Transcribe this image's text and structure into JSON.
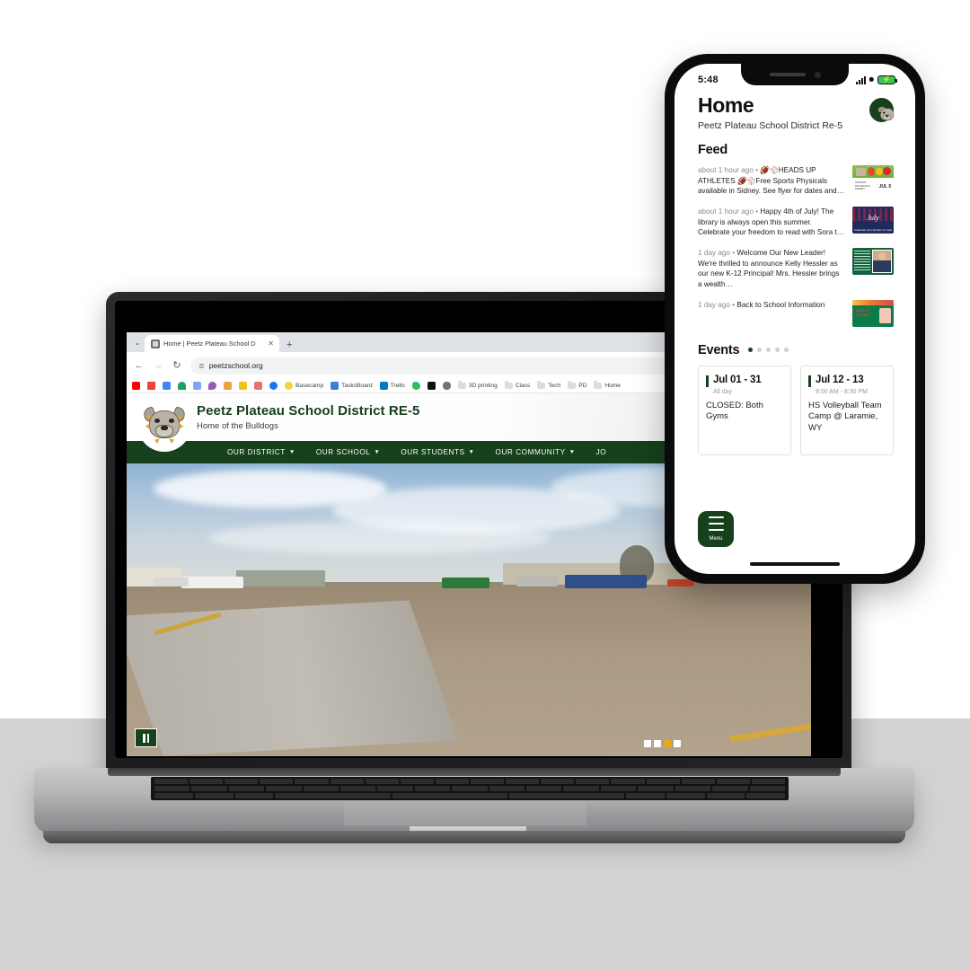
{
  "scene": {
    "background_top": "#ffffff",
    "background_bottom": "#d2d2d2"
  },
  "laptop": {
    "browser": {
      "tab": {
        "title": "Home | Peetz Plateau School D",
        "close_label": "✕",
        "new_tab_label": "+",
        "tab_list_chevron": "⌄"
      },
      "toolbar": {
        "back": "←",
        "forward": "→",
        "reload": "↻",
        "site_settings_icon": "site-settings-icon",
        "url": "peetzschool.org",
        "bookmark_star": "★"
      },
      "extensions": [
        {
          "name": "adblock-extension-icon",
          "color": "#e04a3f"
        },
        {
          "name": "analytics-extension-icon",
          "color": "#1f7a4d"
        },
        {
          "name": "grammar-extension-icon",
          "color": "#3ba55d"
        },
        {
          "name": "privacy-extension-icon",
          "color": "#34c08a"
        },
        {
          "name": "notes-extension-icon",
          "color": "#d8a43a"
        }
      ],
      "bookmarks": [
        {
          "label": "",
          "name": "bookmark-youtube",
          "color": "#ff0000"
        },
        {
          "label": "",
          "name": "bookmark-gmail",
          "color": "#ea4335"
        },
        {
          "label": "",
          "name": "bookmark-calendar",
          "color": "#4285f4"
        },
        {
          "label": "",
          "name": "bookmark-google-drive",
          "color": "#1aa260"
        },
        {
          "label": "",
          "name": "bookmark-photos",
          "color": "#4285f4"
        },
        {
          "label": "",
          "name": "bookmark-brave",
          "color": "#9b59b6"
        },
        {
          "label": "",
          "name": "bookmark-slack",
          "color": "#e8a33d"
        },
        {
          "label": "",
          "name": "bookmark-mailchimp",
          "color": "#ffe01b"
        },
        {
          "label": "",
          "name": "bookmark-dropbox",
          "color": "#e8554e"
        },
        {
          "label": "",
          "name": "bookmark-facebook",
          "color": "#1877f2"
        },
        {
          "label": "Basecamp",
          "name": "bookmark-basecamp",
          "color": "#f5d33f"
        },
        {
          "label": "TasksBoard",
          "name": "bookmark-tasksboard",
          "color": "#3b7ddd"
        },
        {
          "label": "Trello",
          "name": "bookmark-trello",
          "color": "#0079bf"
        },
        {
          "label": "",
          "name": "bookmark-evernote",
          "color": "#2dbe60"
        },
        {
          "label": "",
          "name": "bookmark-x",
          "color": "#111111"
        },
        {
          "label": "",
          "name": "bookmark-bulldog",
          "color": "#7a7468"
        },
        {
          "label": "3D printing",
          "name": "bookmark-folder-3d-printing",
          "color": "#dadce0"
        },
        {
          "label": "Class",
          "name": "bookmark-folder-class",
          "color": "#dadce0"
        },
        {
          "label": "Tech",
          "name": "bookmark-folder-tech",
          "color": "#dadce0"
        },
        {
          "label": "PD",
          "name": "bookmark-folder-pd",
          "color": "#dadce0"
        },
        {
          "label": "Home",
          "name": "bookmark-folder-home",
          "color": "#dadce0"
        }
      ]
    },
    "site": {
      "title": "Peetz Plateau School District RE-5",
      "tagline": "Home of the Bulldogs",
      "brand_color": "#17401c",
      "nav": [
        {
          "label": "OUR DISTRICT",
          "has_dropdown": true
        },
        {
          "label": "OUR SCHOOL",
          "has_dropdown": true
        },
        {
          "label": "OUR STUDENTS",
          "has_dropdown": true
        },
        {
          "label": "OUR COMMUNITY",
          "has_dropdown": true
        },
        {
          "label": "JO",
          "has_dropdown": false
        }
      ],
      "carousel": {
        "pause_label": "‖",
        "slide_count": 4,
        "active_slide": 3,
        "active_color": "#e8a820"
      }
    }
  },
  "phone": {
    "status_bar": {
      "time": "5:48",
      "cellular_icon": "cellular-signal-icon",
      "wifi_icon": "wifi-icon",
      "battery_icon": "battery-charging-icon",
      "battery_charging_glyph": "⚡"
    },
    "header": {
      "title": "Home",
      "subtitle": "Peetz Plateau School District Re-5",
      "avatar_name": "school-logo-avatar"
    },
    "feed": {
      "section_title": "Feed",
      "items": [
        {
          "ago": "about 1 hour ago",
          "separator": "•",
          "text": "🏈⚾HEADS UP ATHLETES 🏈⚾Free Sports Physicals available in Sidney. See flyer for dates and…",
          "thumb": "sports-physicals-flyer"
        },
        {
          "ago": "about 1 hour ago",
          "separator": "•",
          "text": "Happy 4th of July! The library is always open this summer. Celebrate your freedom to read with Sora t…",
          "thumb": "july-fourth-flyer"
        },
        {
          "ago": "1 day ago",
          "separator": "•",
          "text": "Welcome Our New Leader! We're thrilled to announce Kelly Hessler as our new K-12 Principal! Mrs. Hessler brings a wealth…",
          "thumb": "new-principal-announcement"
        },
        {
          "ago": "1 day ago",
          "separator": "•",
          "text": "Back to School Information",
          "thumb": "back-to-school-flyer"
        }
      ]
    },
    "events": {
      "section_title": "Events",
      "page_dots": 5,
      "active_dot": 1,
      "cards": [
        {
          "date": "Jul 01 - 31",
          "time": "All day",
          "name": "CLOSED: Both Gyms"
        },
        {
          "date": "Jul 12 - 13",
          "time": "8:00 AM - 8:30 PM",
          "name": "HS Volleyball Team Camp @ Laramie, WY"
        }
      ]
    },
    "menu_button": {
      "label": "Menu",
      "icon": "hamburger-menu-icon"
    }
  }
}
